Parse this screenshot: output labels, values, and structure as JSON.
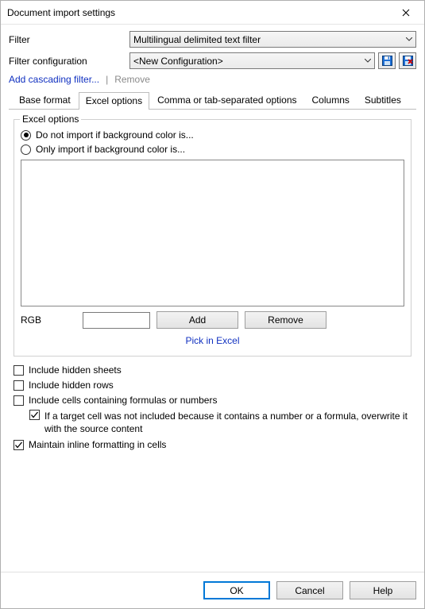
{
  "window": {
    "title": "Document import settings"
  },
  "form": {
    "filter_label": "Filter",
    "filter_value": "Multilingual delimited text filter",
    "config_label": "Filter configuration",
    "config_value": "<New Configuration>"
  },
  "links": {
    "add_cascading": "Add cascading filter...",
    "separator": "|",
    "remove": "Remove"
  },
  "tabs": {
    "base": "Base format",
    "excel": "Excel options",
    "csv": "Comma or tab-separated options",
    "columns": "Columns",
    "subtitles": "Subtitles"
  },
  "excel": {
    "group_title": "Excel options",
    "radio_not_import": "Do not import if background color is...",
    "radio_only_import": "Only import if background color is...",
    "rgb_label": "RGB",
    "rgb_value": "",
    "add_btn": "Add",
    "remove_btn": "Remove",
    "pick_link": "Pick in Excel",
    "chk_hidden_sheets": "Include hidden sheets",
    "chk_hidden_rows": "Include hidden rows",
    "chk_formulas": "Include cells containing formulas or numbers",
    "chk_overwrite": "If a target cell was not included because it contains a number or a formula, overwrite it with the source content",
    "chk_inline_format": "Maintain inline formatting in cells"
  },
  "buttons": {
    "ok": "OK",
    "cancel": "Cancel",
    "help": "Help"
  }
}
